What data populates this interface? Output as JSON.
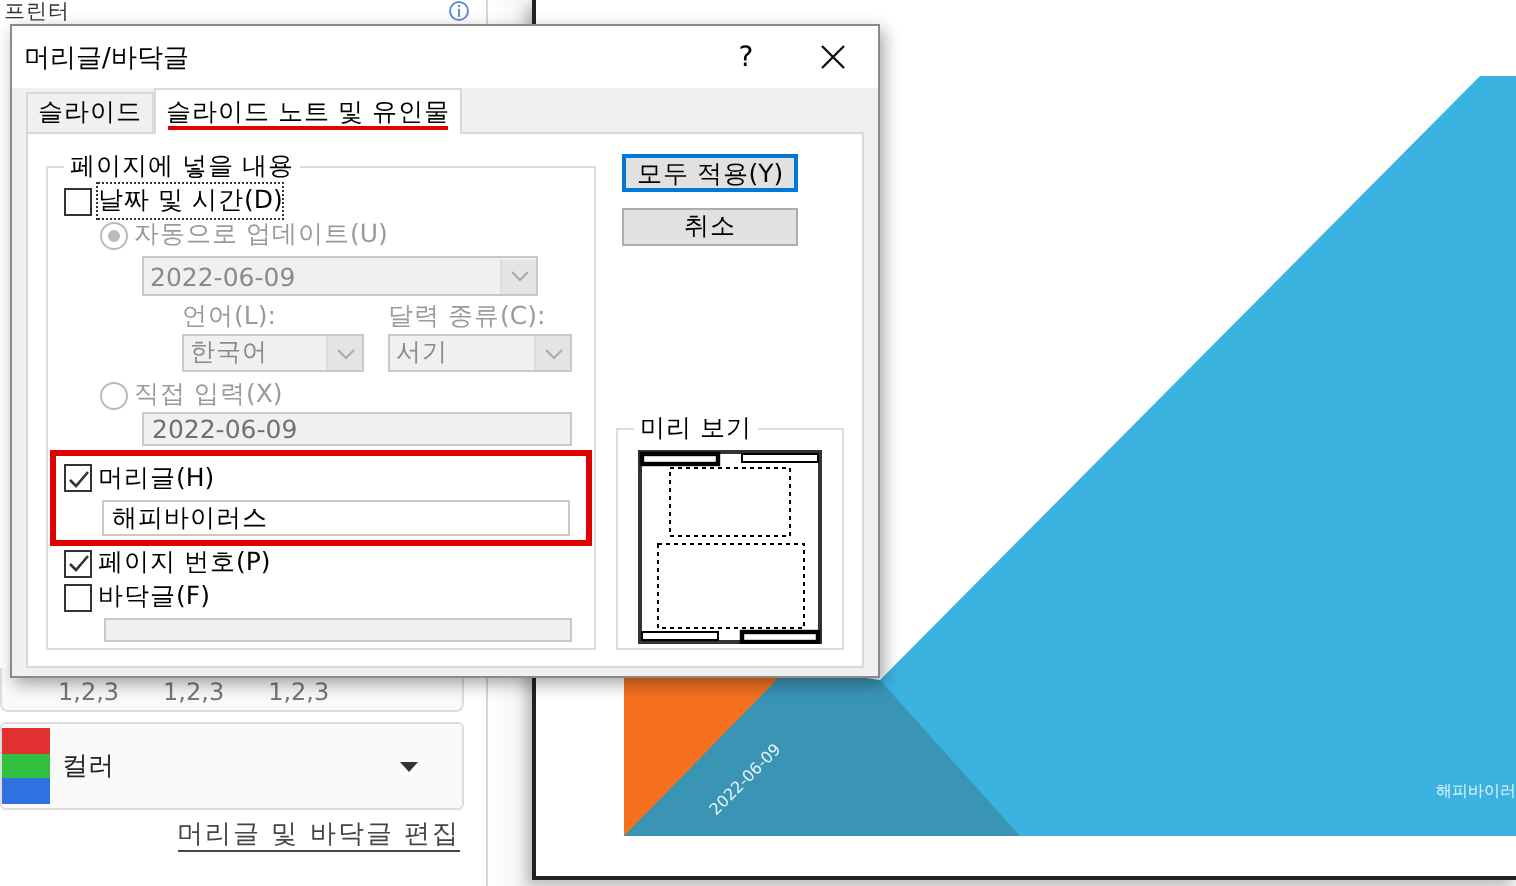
{
  "backdrop": {
    "panel_heading": "프린터",
    "page_number_formats": [
      "1,2,3",
      "1,2,3",
      "1,2,3"
    ],
    "color_dropdown": {
      "value": "컬러"
    },
    "edit_link": "머리글 및 바닥글 편집",
    "slide_preview": {
      "date": "2022-06-09",
      "header": "해피바이러"
    }
  },
  "dialog": {
    "title": "머리글/바닥글",
    "help": "?",
    "tabs": [
      {
        "label": "슬라이드",
        "selected": false,
        "annotated": false
      },
      {
        "label": "슬라이드 노트 및 유인물",
        "selected": true,
        "annotated": true
      }
    ],
    "group_title": "페이지에 넣을 내용",
    "date_time": {
      "label": "날짜 및 시간(D)",
      "checked": false
    },
    "auto_update": {
      "label": "자동으로 업데이트(U)",
      "selected": true,
      "value": "2022-06-09"
    },
    "language": {
      "label": "언어(L):",
      "value": "한국어"
    },
    "calendar": {
      "label": "달력 종류(C):",
      "value": "서기"
    },
    "fixed": {
      "label": "직접 입력(X)",
      "selected": false,
      "value": "2022-06-09"
    },
    "header": {
      "label": "머리글(H)",
      "checked": true,
      "value": "해피바이러스",
      "annotated": true
    },
    "page_number": {
      "label": "페이지 번호(P)",
      "checked": true
    },
    "footer": {
      "label": "바닥글(F)",
      "checked": false
    },
    "buttons": [
      {
        "label": "모두 적용(Y)",
        "default": true
      },
      {
        "label": "취소",
        "default": false
      }
    ],
    "preview_title": "미리 보기"
  }
}
